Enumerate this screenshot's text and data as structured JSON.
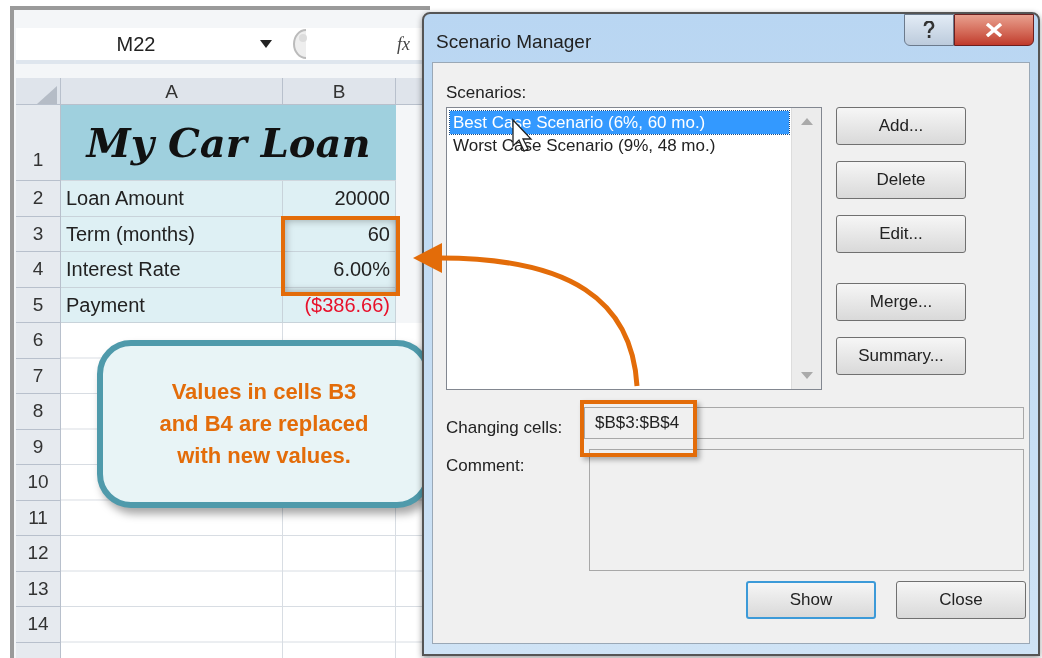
{
  "spreadsheet": {
    "name_box": "M22",
    "formula_label": "fx",
    "columns": [
      "A",
      "B"
    ],
    "title_row": {
      "number": "1",
      "text": "My Car Loan"
    },
    "rows": [
      {
        "number": "2",
        "label": "Loan Amount",
        "value": "20000",
        "negative": false
      },
      {
        "number": "3",
        "label": "Term (months)",
        "value": "60",
        "negative": false
      },
      {
        "number": "4",
        "label": "Interest Rate",
        "value": "6.00%",
        "negative": false
      },
      {
        "number": "5",
        "label": "Payment",
        "value": "($386.66)",
        "negative": true
      }
    ],
    "empty_rows": [
      "6",
      "7",
      "8",
      "9",
      "10",
      "11",
      "12",
      "13",
      "14"
    ]
  },
  "callout": {
    "text": "Values in cells B3 and B4 are replaced with new values."
  },
  "dialog": {
    "title": "Scenario Manager",
    "scenarios_label": "Scenarios:",
    "scenarios": [
      {
        "label": "Best Case Scenario (6%, 60 mo.)",
        "selected": true
      },
      {
        "label": "Worst Case Scenario (9%, 48 mo.)",
        "selected": false
      }
    ],
    "side_buttons": [
      [
        "Add...",
        "Delete",
        "Edit..."
      ],
      [
        "Merge...",
        "Summary..."
      ]
    ],
    "changing_cells_label": "Changing cells:",
    "changing_cells": "$B$3:$B$4",
    "comment_label": "Comment:",
    "footer_buttons": [
      {
        "label": "Show",
        "default": true
      },
      {
        "label": "Close",
        "default": false
      }
    ]
  }
}
